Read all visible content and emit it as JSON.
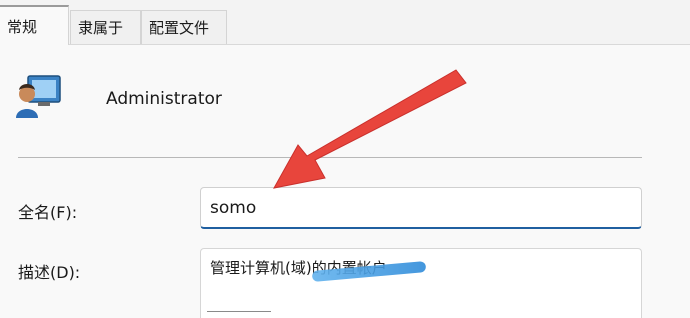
{
  "tabs": [
    {
      "label": "常规",
      "active": true
    },
    {
      "label": "隶属于",
      "active": false
    },
    {
      "label": "配置文件",
      "active": false
    }
  ],
  "user": {
    "name": "Administrator",
    "avatar_icon": "user-account-icon"
  },
  "form": {
    "fullname_label": "全名(F):",
    "fullname_value": "somo",
    "description_label": "描述(D):",
    "description_value": "管理计算机(域)的内置帐户"
  },
  "colors": {
    "focus_underline": "#1f5fa0",
    "annotation_arrow": "#e8453c",
    "smudge": "#3a96e0"
  }
}
